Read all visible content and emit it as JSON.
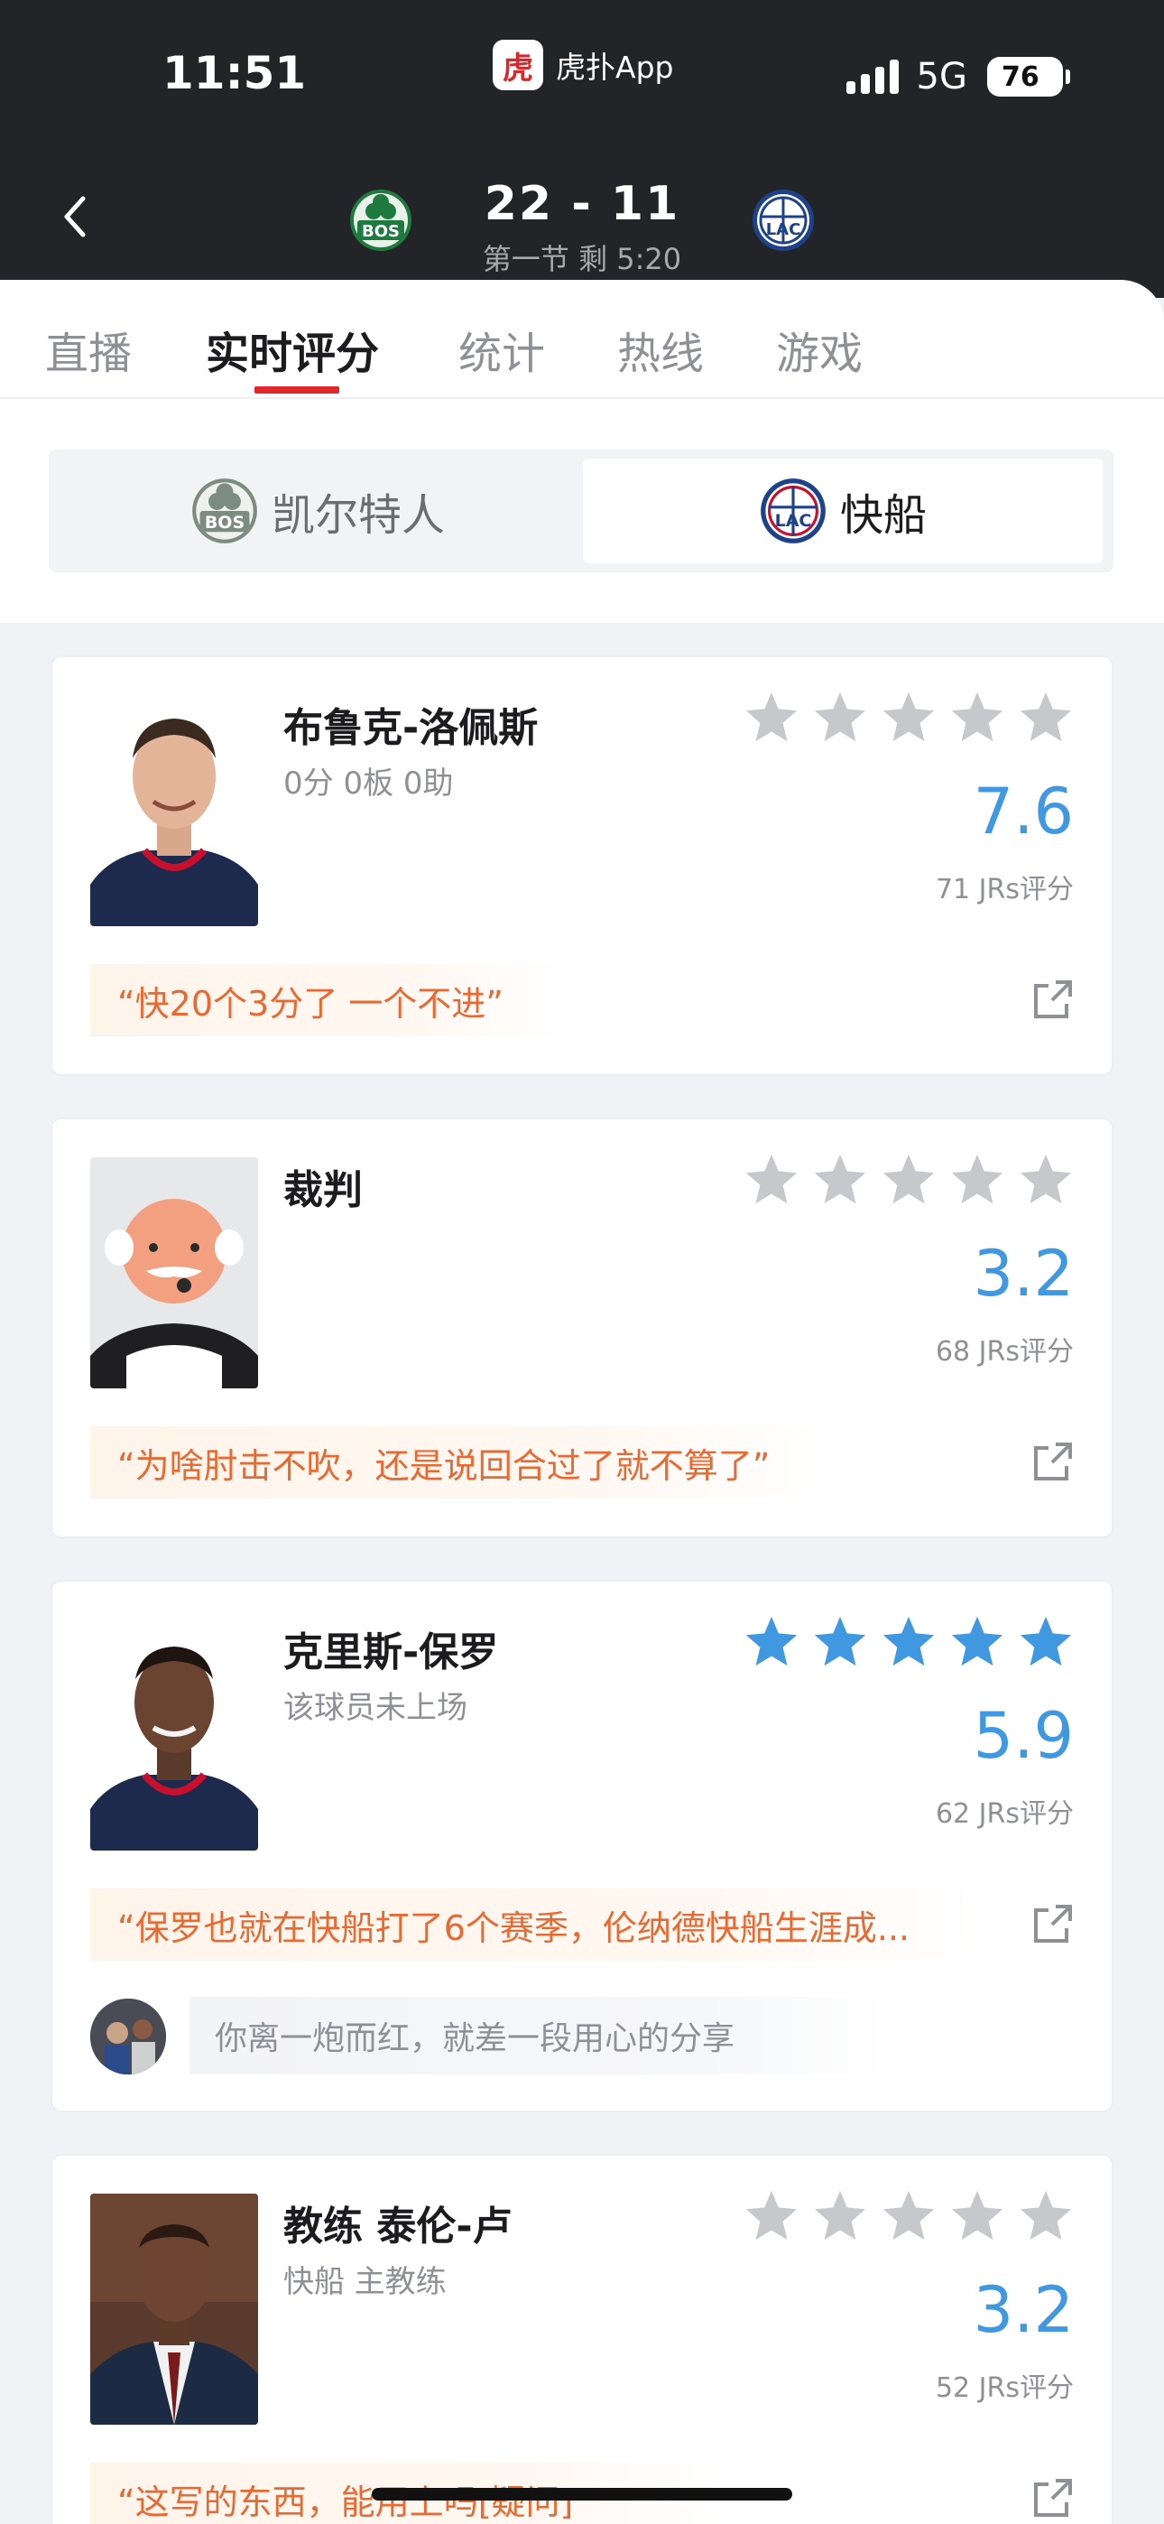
{
  "status_bar": {
    "time": "11:51",
    "app_name": "虎扑App",
    "network": "5G",
    "battery": "76"
  },
  "header": {
    "score": "22 - 11",
    "period": "第一节 剩 5:20",
    "home_team_abbr": "BOS",
    "away_team_abbr": "LAC"
  },
  "tabs": [
    {
      "label": "直播"
    },
    {
      "label": "实时评分",
      "active": true
    },
    {
      "label": "统计"
    },
    {
      "label": "热线"
    },
    {
      "label": "游戏"
    }
  ],
  "team_switch": {
    "left": "凯尔特人",
    "right": "快船",
    "selected": "right"
  },
  "colors": {
    "accent_red": "#e2262d",
    "rating_blue": "#3f98e0",
    "quote_orange": "#e86a33",
    "star_gray": "#c7c8cc"
  },
  "cards": [
    {
      "name": "布鲁克-洛佩斯",
      "subtitle": "0分 0板 0助",
      "stars_filled": 0,
      "rating": "7.6",
      "votes": "71 JRs评分",
      "quote": "“快20个3分了 一个不进”"
    },
    {
      "name": "裁判",
      "subtitle": "",
      "stars_filled": 0,
      "rating": "3.2",
      "votes": "68 JRs评分",
      "quote": "“为啥肘击不吹，还是说回合过了就不算了”"
    },
    {
      "name": "克里斯-保罗",
      "subtitle": "该球员未上场",
      "stars_filled": 5,
      "rating": "5.9",
      "votes": "62 JRs评分",
      "quote": "“保罗也就在快船打了6个赛季，伦纳德快船生涯成...",
      "comment_placeholder": "你离一炮而红，就差一段用心的分享"
    },
    {
      "name": "教练 泰伦-卢",
      "subtitle": "快船 主教练",
      "stars_filled": 0,
      "rating": "3.2",
      "votes": "52 JRs评分",
      "quote": "“这写的东西，能用上吗[疑问]"
    }
  ]
}
